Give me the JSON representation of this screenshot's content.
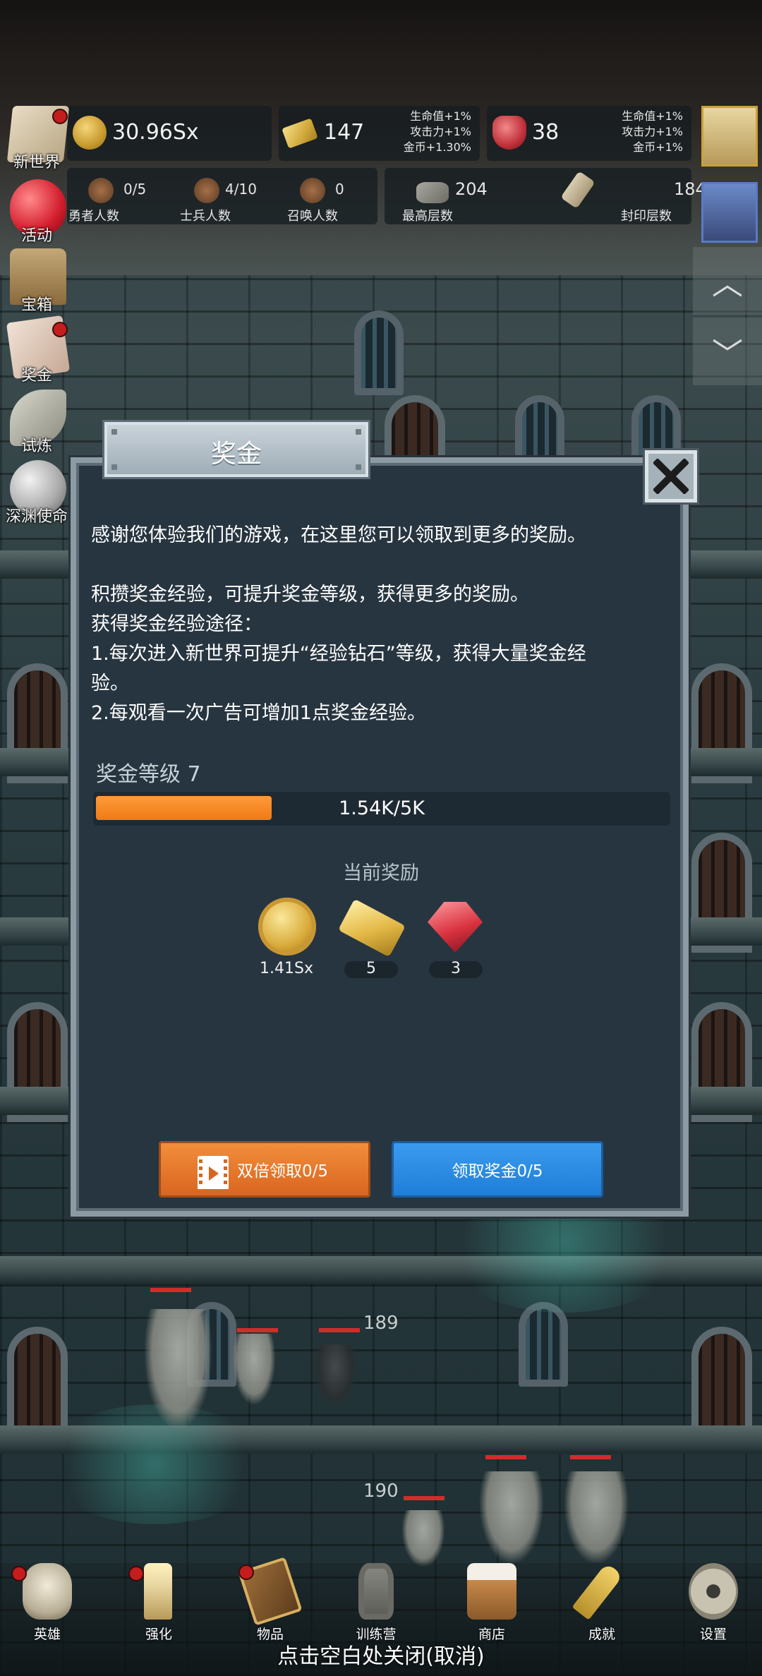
{
  "hud": {
    "gold": {
      "value": "30.96Sx",
      "icon": "gold-coin-icon"
    },
    "gold_bar": {
      "value": "147",
      "icon": "gold-bar-icon",
      "bonus": [
        "生命值+1%",
        "攻击力+1%",
        "金币+1.30%"
      ]
    },
    "gem": {
      "value": "38",
      "icon": "red-gem-icon",
      "bonus": [
        "生命值+1%",
        "攻击力+1%",
        "金币+1%"
      ]
    },
    "stats": [
      {
        "value": "0/5",
        "label": "勇者人数",
        "icon": "hero-icon"
      },
      {
        "value": "4/10",
        "label": "士兵人数",
        "icon": "soldier-icon"
      },
      {
        "value": "0",
        "label": "召唤人数",
        "icon": "summon-icon"
      },
      {
        "value": "204",
        "label": "最高层数",
        "icon": "stone-icon"
      },
      {
        "value": "184",
        "label": "封印层数",
        "icon": "scroll-icon"
      }
    ]
  },
  "side_menu": [
    {
      "label": "新世界",
      "icon": "book-icon",
      "dot": true
    },
    {
      "label": "活动",
      "icon": "heart-icon",
      "dot": false
    },
    {
      "label": "宝箱",
      "icon": "chest-icon",
      "dot": false
    },
    {
      "label": "奖金",
      "icon": "envelope-icon",
      "dot": true
    },
    {
      "label": "试炼",
      "icon": "claw-icon",
      "dot": false
    },
    {
      "label": "深渊使命",
      "icon": "orb-icon",
      "dot": false
    }
  ],
  "dialog": {
    "title": "奖金",
    "intro": "感谢您体验我们的游戏，在这里您可以领取到更多的奖励。",
    "desc_lines": [
      "积攒奖金经验，可提升奖金等级，获得更多的奖励。",
      "获得奖金经验途径：",
      "1.每次进入新世界可提升“经验钻石”等级，获得大量奖金经",
      "验。",
      "2.每观看一次广告可增加1点奖金经验。"
    ],
    "level_label": "奖金等级 7",
    "progress_text": "1.54K/5K",
    "progress_fraction": 0.308,
    "rewards_title": "当前奖励",
    "rewards": [
      {
        "icon": "gold-coin-icon",
        "count": "1.41Sx"
      },
      {
        "icon": "gold-bar-icon",
        "count": "5"
      },
      {
        "icon": "red-gem-icon",
        "count": "3"
      }
    ],
    "double_button": "双倍领取0/5",
    "claim_button": "领取奖金0/5"
  },
  "floors": [
    "189",
    "190"
  ],
  "bottom_nav": [
    {
      "label": "英雄",
      "icon": "skull-icon",
      "dot": true
    },
    {
      "label": "强化",
      "icon": "candle-icon",
      "dot": true
    },
    {
      "label": "物品",
      "icon": "book-icon",
      "dot": true
    },
    {
      "label": "训练营",
      "icon": "lantern-icon",
      "dot": false
    },
    {
      "label": "商店",
      "icon": "mug-icon",
      "dot": false
    },
    {
      "label": "成就",
      "icon": "key-icon",
      "dot": false
    },
    {
      "label": "设置",
      "icon": "gear-icon",
      "dot": false
    }
  ],
  "close_hint": "点击空白处关闭(取消)",
  "colors": {
    "accent_orange": "#f07a15",
    "accent_blue": "#1f7ed8",
    "panel": "#273540"
  }
}
